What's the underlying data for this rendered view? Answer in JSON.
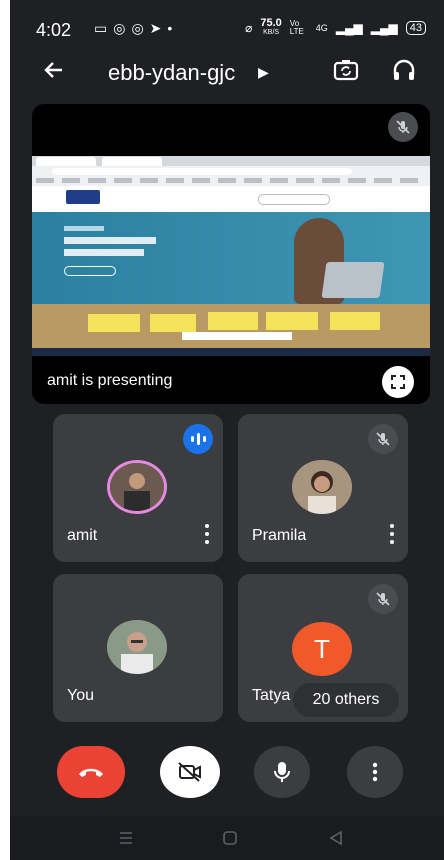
{
  "status_bar": {
    "time": "4:02",
    "notification_icons": [
      "screen-record-icon",
      "whatsapp-icon",
      "whatsapp-icon",
      "telegram-icon",
      "dot-icon"
    ],
    "net_speed": "75.0",
    "net_speed_unit": "KB/S",
    "volte": "Vo LTE",
    "network": "4G",
    "battery": "43"
  },
  "header": {
    "meeting_code": "ebb-ydan-gjc"
  },
  "presentation": {
    "presenter_label": "amit is presenting"
  },
  "participants": [
    {
      "name": "amit",
      "state": "speaking",
      "avatar": "photo"
    },
    {
      "name": "Pramila",
      "state": "muted",
      "avatar": "photo"
    },
    {
      "name": "You",
      "state": "unmuted",
      "avatar": "photo"
    },
    {
      "name": "Tatya",
      "state": "muted",
      "avatar": "initial",
      "initial": "T"
    }
  ],
  "others_chip": "20 others",
  "colors": {
    "background": "#1f2023",
    "tile": "#3c3d41",
    "end_call": "#ea4335",
    "speaking": "#1a73e8",
    "initial_avatar": "#f05a2b"
  }
}
